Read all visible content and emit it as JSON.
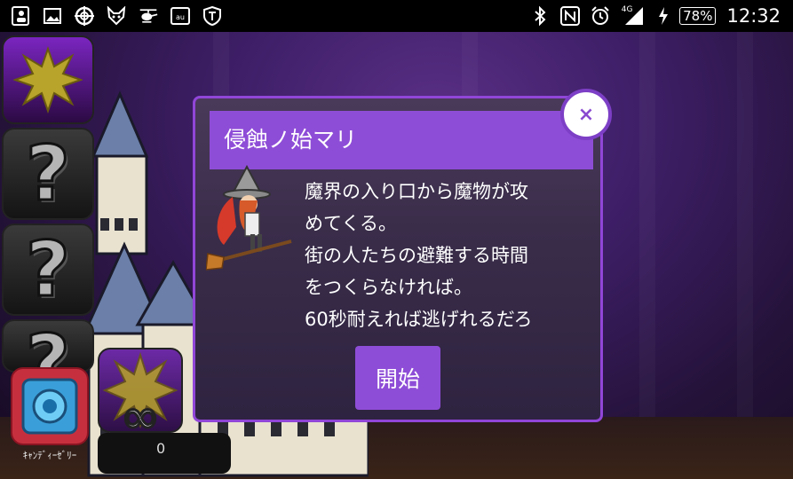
{
  "status_bar": {
    "left_icons": [
      "contact-card-icon",
      "image-icon",
      "target-icon",
      "fox-icon",
      "helicopter-icon",
      "au-icon",
      "shield-t-icon"
    ],
    "network": "4G",
    "battery": "78%",
    "time": "12:32"
  },
  "side_menu": {
    "slots": [
      {
        "state": "selected",
        "icon": "explosion-icon"
      },
      {
        "state": "locked",
        "label": "?"
      },
      {
        "state": "locked",
        "label": "?"
      },
      {
        "state": "locked",
        "label": "?"
      }
    ],
    "candy_label": "ｷｬﾝﾃﾞｨｰｾﾞﾘｰ",
    "infinite_symbol": "∞",
    "bottom_symbol": "0"
  },
  "dialog": {
    "title": "侵蝕ノ始マリ",
    "lines": [
      "魔界の入り口から魔物が攻",
      "めてくる。",
      "街の人たちの避難する時間",
      "をつくらなければ。",
      "60秒耐えれば逃げれるだろ"
    ],
    "start_label": "開始",
    "close_label": "×"
  },
  "colors": {
    "dialog_accent": "#8e4dd7",
    "dialog_border": "#9146d8",
    "scene_bg": "#3d1e66",
    "candy": "#c6303e"
  }
}
